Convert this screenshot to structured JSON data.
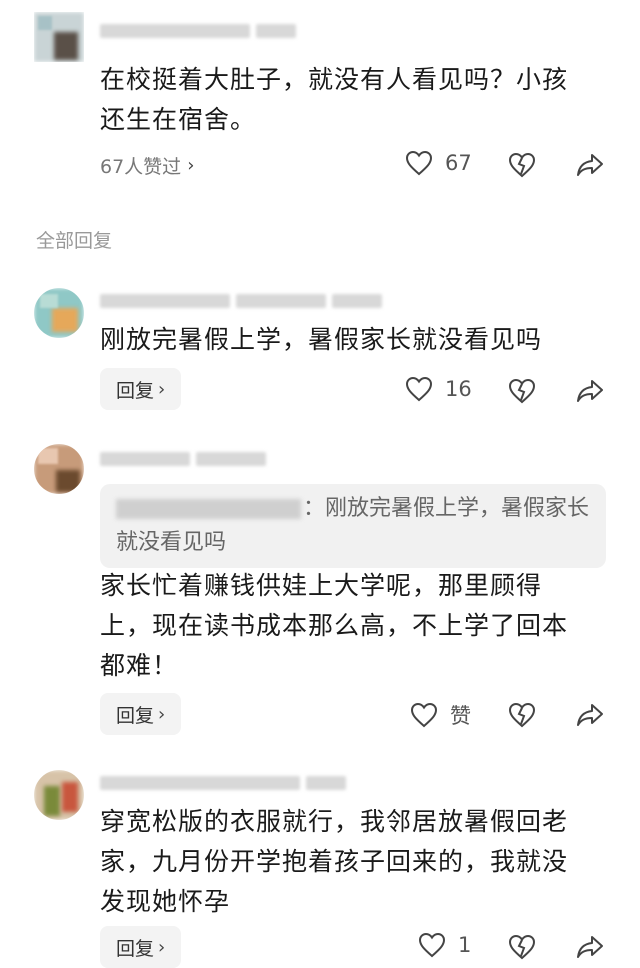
{
  "main_comment": {
    "text": "在校挺着大肚子，就没有人看见吗？小孩还生在宿舍。",
    "likes_summary": "67人赞过",
    "like_count": "67"
  },
  "section_label": "全部回复",
  "replies": [
    {
      "text": "刚放完暑假上学，暑假家长就没看见吗",
      "reply_label": "回复",
      "like_count": "16"
    },
    {
      "quote_suffix": "：刚放完暑假上学，暑假家长就没看见吗",
      "text": "家长忙着赚钱供娃上大学呢，那里顾得上，现在读书成本那么高，不上学了回本都难！",
      "reply_label": "回复",
      "like_count": "赞"
    },
    {
      "text": "穿宽松版的衣服就行，我邻居放暑假回老家，九月份开学抱着孩子回来的，我就没发现她怀孕",
      "reply_label": "回复",
      "like_count": "1"
    }
  ],
  "icons": {
    "like": "heart-outline-icon",
    "dislike": "broken-heart-icon",
    "share": "share-arrow-icon",
    "chevron": "chevron-right-icon"
  },
  "colors": {
    "text": "#1a1a1a",
    "meta": "#777777",
    "button_bg": "#f3f3f3",
    "quote_bg": "#f1f1f1"
  }
}
